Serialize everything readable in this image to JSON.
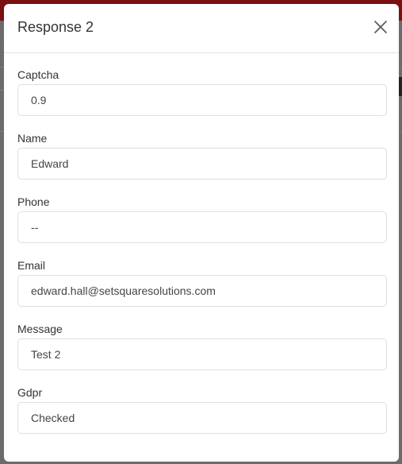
{
  "modal": {
    "title": "Response 2",
    "close_icon": "close-icon"
  },
  "fields": [
    {
      "label": "Captcha",
      "value": "0.9"
    },
    {
      "label": "Name",
      "value": "Edward"
    },
    {
      "label": "Phone",
      "value": "--"
    },
    {
      "label": "Email",
      "value": "edward.hall@setsquaresolutions.com"
    },
    {
      "label": "Message",
      "value": "Test 2"
    },
    {
      "label": "Gdpr",
      "value": "Checked"
    }
  ],
  "colors": {
    "backdrop": "#5f5f5f",
    "top_bar": "#7a1010",
    "modal_bg": "#ffffff",
    "border": "#dee2e6"
  }
}
